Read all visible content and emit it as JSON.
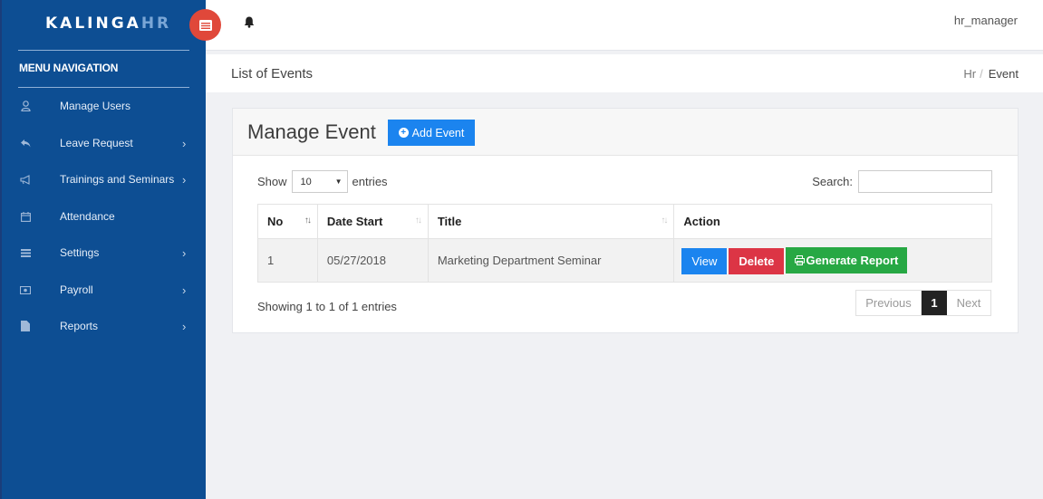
{
  "brand": {
    "main": "KALINGA",
    "accent": "HR"
  },
  "sidebar": {
    "heading": "MENU NAVIGATION",
    "items": [
      {
        "label": "Manage Users",
        "icon": "user-icon",
        "has_submenu": false
      },
      {
        "label": "Leave Request",
        "icon": "reply-icon",
        "has_submenu": true
      },
      {
        "label": "Trainings and Seminars",
        "icon": "megaphone-icon",
        "has_submenu": true
      },
      {
        "label": "Attendance",
        "icon": "calendar-icon",
        "has_submenu": false
      },
      {
        "label": "Settings",
        "icon": "list-icon",
        "has_submenu": true
      },
      {
        "label": "Payroll",
        "icon": "money-icon",
        "has_submenu": true
      },
      {
        "label": "Reports",
        "icon": "file-icon",
        "has_submenu": true
      }
    ]
  },
  "topbar": {
    "username": "hr_manager"
  },
  "titlebar": {
    "title": "List of Events",
    "breadcrumb": [
      "Hr",
      "Event"
    ]
  },
  "card": {
    "title": "Manage Event",
    "add_button": "Add Event",
    "length": {
      "prefix": "Show",
      "selected": "10",
      "suffix": "entries"
    },
    "search_label": "Search:",
    "columns": [
      "No",
      "Date Start",
      "Title",
      "Action"
    ],
    "rows": [
      {
        "no": "1",
        "date_start": "05/27/2018",
        "title": "Marketing Department Seminar"
      }
    ],
    "actions": {
      "view": "View",
      "delete": "Delete",
      "report": "Generate Report"
    },
    "info": "Showing 1 to 1 of 1 entries",
    "pagination": {
      "previous": "Previous",
      "current": "1",
      "next": "Next"
    }
  },
  "colors": {
    "sidebar": "#0d4e93",
    "primary": "#1b84ef",
    "danger": "#dc3545",
    "success": "#27a844",
    "toggle": "#e0483a"
  }
}
